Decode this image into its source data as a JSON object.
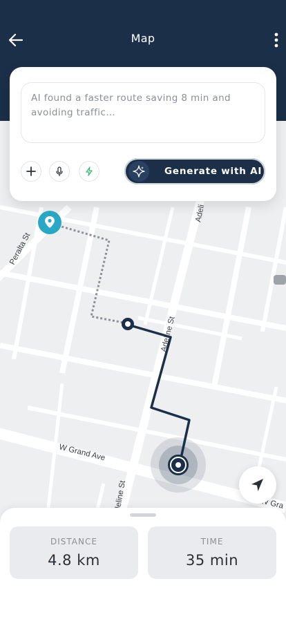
{
  "header": {
    "title": "Map",
    "back_icon": "arrow-left-icon",
    "more_icon": "more-vertical-icon"
  },
  "ai_card": {
    "suggestion_text": "AI found a faster route saving 8 min and avoiding traffic…",
    "tools": [
      "plus-icon",
      "microphone-icon",
      "lightning-icon"
    ],
    "generate_label": "Generate with AI",
    "generate_icon": "sparkle-icon"
  },
  "map": {
    "street_labels": {
      "peralta": "Peralta St",
      "adeline_top": "Adeli",
      "adeline_mid": "Adeline St",
      "adeline_bottom": "Adeline St",
      "w_grand": "W Grand Ave",
      "w_grand_right": "W Gra"
    },
    "colors": {
      "route": "#1b2f48",
      "destination_pin": "#29a8c6",
      "map_bg": "#eeeff1",
      "road": "#ffffff"
    },
    "locate_icon": "navigation-arrow-icon"
  },
  "stats": {
    "distance": {
      "label": "DISTANCE",
      "value": "4.8 km"
    },
    "time": {
      "label": "TIME",
      "value": "35 min"
    }
  }
}
